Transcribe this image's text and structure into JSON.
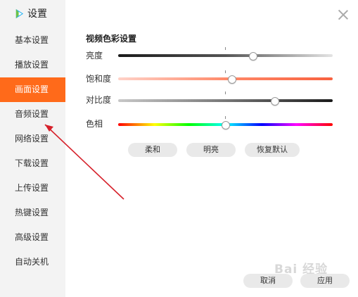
{
  "app": {
    "title": "设置"
  },
  "sidebar": {
    "items": [
      {
        "label": "基本设置",
        "active": false
      },
      {
        "label": "播放设置",
        "active": false
      },
      {
        "label": "画面设置",
        "active": true
      },
      {
        "label": "音频设置",
        "active": false
      },
      {
        "label": "网络设置",
        "active": false
      },
      {
        "label": "下载设置",
        "active": false
      },
      {
        "label": "上传设置",
        "active": false
      },
      {
        "label": "热键设置",
        "active": false
      },
      {
        "label": "高级设置",
        "active": false
      },
      {
        "label": "自动关机",
        "active": false
      }
    ]
  },
  "section": {
    "title": "视频色彩设置"
  },
  "sliders": {
    "brightness": {
      "label": "亮度",
      "value": 0.63
    },
    "saturation": {
      "label": "饱和度",
      "value": 0.53
    },
    "contrast": {
      "label": "对比度",
      "value": 0.73
    },
    "hue": {
      "label": "色相",
      "value": 0.5
    }
  },
  "presets": {
    "soft": "柔和",
    "bright": "明亮",
    "reset": "恢复默认"
  },
  "footer": {
    "cancel": "取消",
    "apply": "应用"
  },
  "watermark": "Bai 经验",
  "colors": {
    "accent": "#ff6a1a",
    "annotation_arrow": "#d6202a"
  }
}
